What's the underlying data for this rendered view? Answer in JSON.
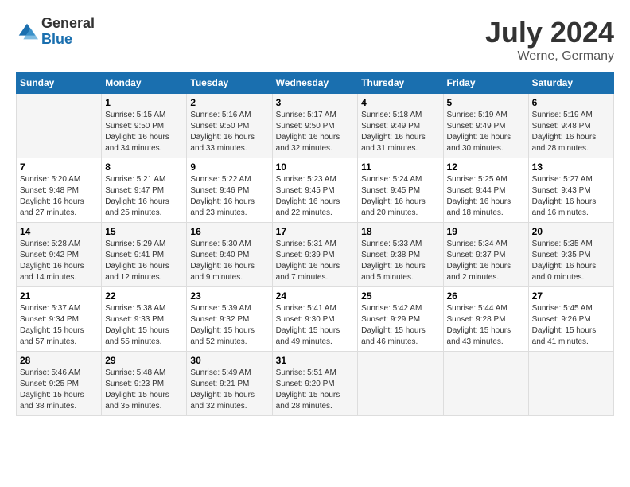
{
  "header": {
    "logo_general": "General",
    "logo_blue": "Blue",
    "title": "July 2024",
    "location": "Werne, Germany"
  },
  "days_of_week": [
    "Sunday",
    "Monday",
    "Tuesday",
    "Wednesday",
    "Thursday",
    "Friday",
    "Saturday"
  ],
  "weeks": [
    [
      {
        "day": "",
        "sunrise": "",
        "sunset": "",
        "daylight": ""
      },
      {
        "day": "1",
        "sunrise": "Sunrise: 5:15 AM",
        "sunset": "Sunset: 9:50 PM",
        "daylight": "Daylight: 16 hours and 34 minutes."
      },
      {
        "day": "2",
        "sunrise": "Sunrise: 5:16 AM",
        "sunset": "Sunset: 9:50 PM",
        "daylight": "Daylight: 16 hours and 33 minutes."
      },
      {
        "day": "3",
        "sunrise": "Sunrise: 5:17 AM",
        "sunset": "Sunset: 9:50 PM",
        "daylight": "Daylight: 16 hours and 32 minutes."
      },
      {
        "day": "4",
        "sunrise": "Sunrise: 5:18 AM",
        "sunset": "Sunset: 9:49 PM",
        "daylight": "Daylight: 16 hours and 31 minutes."
      },
      {
        "day": "5",
        "sunrise": "Sunrise: 5:19 AM",
        "sunset": "Sunset: 9:49 PM",
        "daylight": "Daylight: 16 hours and 30 minutes."
      },
      {
        "day": "6",
        "sunrise": "Sunrise: 5:19 AM",
        "sunset": "Sunset: 9:48 PM",
        "daylight": "Daylight: 16 hours and 28 minutes."
      }
    ],
    [
      {
        "day": "7",
        "sunrise": "Sunrise: 5:20 AM",
        "sunset": "Sunset: 9:48 PM",
        "daylight": "Daylight: 16 hours and 27 minutes."
      },
      {
        "day": "8",
        "sunrise": "Sunrise: 5:21 AM",
        "sunset": "Sunset: 9:47 PM",
        "daylight": "Daylight: 16 hours and 25 minutes."
      },
      {
        "day": "9",
        "sunrise": "Sunrise: 5:22 AM",
        "sunset": "Sunset: 9:46 PM",
        "daylight": "Daylight: 16 hours and 23 minutes."
      },
      {
        "day": "10",
        "sunrise": "Sunrise: 5:23 AM",
        "sunset": "Sunset: 9:45 PM",
        "daylight": "Daylight: 16 hours and 22 minutes."
      },
      {
        "day": "11",
        "sunrise": "Sunrise: 5:24 AM",
        "sunset": "Sunset: 9:45 PM",
        "daylight": "Daylight: 16 hours and 20 minutes."
      },
      {
        "day": "12",
        "sunrise": "Sunrise: 5:25 AM",
        "sunset": "Sunset: 9:44 PM",
        "daylight": "Daylight: 16 hours and 18 minutes."
      },
      {
        "day": "13",
        "sunrise": "Sunrise: 5:27 AM",
        "sunset": "Sunset: 9:43 PM",
        "daylight": "Daylight: 16 hours and 16 minutes."
      }
    ],
    [
      {
        "day": "14",
        "sunrise": "Sunrise: 5:28 AM",
        "sunset": "Sunset: 9:42 PM",
        "daylight": "Daylight: 16 hours and 14 minutes."
      },
      {
        "day": "15",
        "sunrise": "Sunrise: 5:29 AM",
        "sunset": "Sunset: 9:41 PM",
        "daylight": "Daylight: 16 hours and 12 minutes."
      },
      {
        "day": "16",
        "sunrise": "Sunrise: 5:30 AM",
        "sunset": "Sunset: 9:40 PM",
        "daylight": "Daylight: 16 hours and 9 minutes."
      },
      {
        "day": "17",
        "sunrise": "Sunrise: 5:31 AM",
        "sunset": "Sunset: 9:39 PM",
        "daylight": "Daylight: 16 hours and 7 minutes."
      },
      {
        "day": "18",
        "sunrise": "Sunrise: 5:33 AM",
        "sunset": "Sunset: 9:38 PM",
        "daylight": "Daylight: 16 hours and 5 minutes."
      },
      {
        "day": "19",
        "sunrise": "Sunrise: 5:34 AM",
        "sunset": "Sunset: 9:37 PM",
        "daylight": "Daylight: 16 hours and 2 minutes."
      },
      {
        "day": "20",
        "sunrise": "Sunrise: 5:35 AM",
        "sunset": "Sunset: 9:35 PM",
        "daylight": "Daylight: 16 hours and 0 minutes."
      }
    ],
    [
      {
        "day": "21",
        "sunrise": "Sunrise: 5:37 AM",
        "sunset": "Sunset: 9:34 PM",
        "daylight": "Daylight: 15 hours and 57 minutes."
      },
      {
        "day": "22",
        "sunrise": "Sunrise: 5:38 AM",
        "sunset": "Sunset: 9:33 PM",
        "daylight": "Daylight: 15 hours and 55 minutes."
      },
      {
        "day": "23",
        "sunrise": "Sunrise: 5:39 AM",
        "sunset": "Sunset: 9:32 PM",
        "daylight": "Daylight: 15 hours and 52 minutes."
      },
      {
        "day": "24",
        "sunrise": "Sunrise: 5:41 AM",
        "sunset": "Sunset: 9:30 PM",
        "daylight": "Daylight: 15 hours and 49 minutes."
      },
      {
        "day": "25",
        "sunrise": "Sunrise: 5:42 AM",
        "sunset": "Sunset: 9:29 PM",
        "daylight": "Daylight: 15 hours and 46 minutes."
      },
      {
        "day": "26",
        "sunrise": "Sunrise: 5:44 AM",
        "sunset": "Sunset: 9:28 PM",
        "daylight": "Daylight: 15 hours and 43 minutes."
      },
      {
        "day": "27",
        "sunrise": "Sunrise: 5:45 AM",
        "sunset": "Sunset: 9:26 PM",
        "daylight": "Daylight: 15 hours and 41 minutes."
      }
    ],
    [
      {
        "day": "28",
        "sunrise": "Sunrise: 5:46 AM",
        "sunset": "Sunset: 9:25 PM",
        "daylight": "Daylight: 15 hours and 38 minutes."
      },
      {
        "day": "29",
        "sunrise": "Sunrise: 5:48 AM",
        "sunset": "Sunset: 9:23 PM",
        "daylight": "Daylight: 15 hours and 35 minutes."
      },
      {
        "day": "30",
        "sunrise": "Sunrise: 5:49 AM",
        "sunset": "Sunset: 9:21 PM",
        "daylight": "Daylight: 15 hours and 32 minutes."
      },
      {
        "day": "31",
        "sunrise": "Sunrise: 5:51 AM",
        "sunset": "Sunset: 9:20 PM",
        "daylight": "Daylight: 15 hours and 28 minutes."
      },
      {
        "day": "",
        "sunrise": "",
        "sunset": "",
        "daylight": ""
      },
      {
        "day": "",
        "sunrise": "",
        "sunset": "",
        "daylight": ""
      },
      {
        "day": "",
        "sunrise": "",
        "sunset": "",
        "daylight": ""
      }
    ]
  ]
}
